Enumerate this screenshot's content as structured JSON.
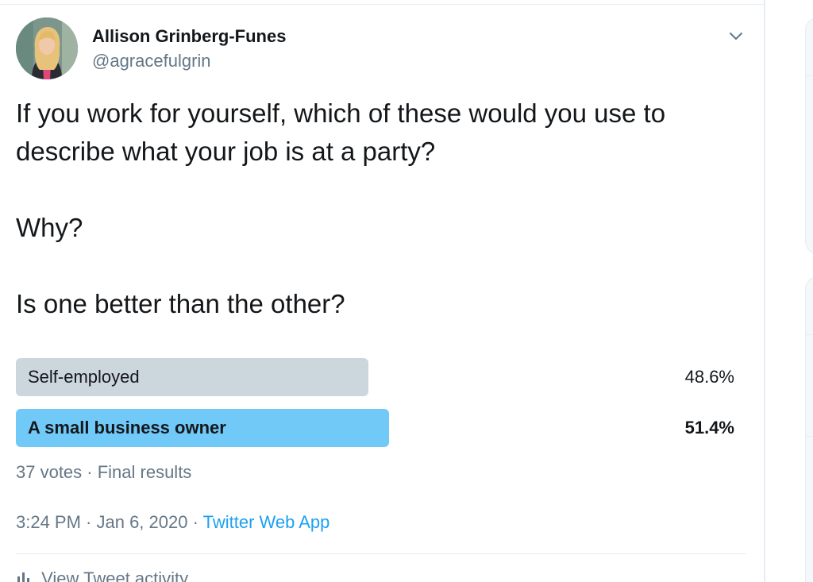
{
  "tweet": {
    "author_name": "Allison Grinberg-Funes",
    "author_handle": "@agracefulgrin",
    "avatar_icon": "avatar-photo",
    "menu_icon": "chevron-down-icon",
    "text_lines": [
      "If you work for yourself, which of these would you use to",
      "describe what your job is at a party?",
      "Why?",
      "Is one better than the other?"
    ],
    "poll": {
      "options": [
        {
          "label": "Self-employed",
          "percent_label": "48.6%",
          "percent": 48.6,
          "winner": false
        },
        {
          "label": "A small business owner",
          "percent_label": "51.4%",
          "percent": 51.4,
          "winner": true
        }
      ],
      "meta": "37 votes · Final results"
    },
    "time": "3:24 PM · Jan 6, 2020 ·",
    "source": "Twitter Web App",
    "activity_label": "View Tweet activity"
  },
  "colors": {
    "poll_winner": "#71c9f8",
    "poll_other": "#ccd6dd",
    "link": "#1da1f2",
    "secondary_text": "#657786"
  }
}
